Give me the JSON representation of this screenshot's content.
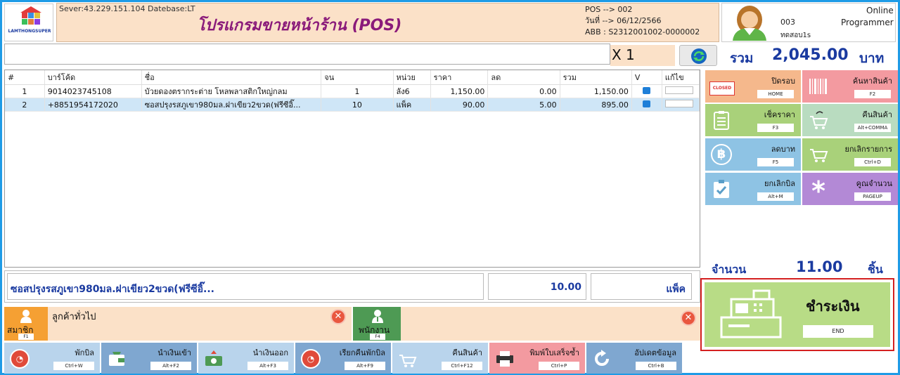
{
  "header": {
    "server": "Sever:43.229.151.104 Datebase:LT",
    "title": "โปรแกรมขายหน้าร้าน (POS)",
    "pos": "POS --> 002",
    "date": "วันที่ --> 06/12/2566",
    "abb": "ABB : S2312001002-0000002"
  },
  "logo": {
    "text": "LAMTHONGSUPER"
  },
  "user": {
    "status": "Online",
    "code": "003",
    "role": "Programmer",
    "name": "ทดสอบ1s"
  },
  "scan": {
    "value": "",
    "multiplier": "X 1"
  },
  "total": {
    "label": "รวม",
    "value": "2,045.00",
    "currency": "บาท"
  },
  "grid": {
    "headers": [
      "#",
      "บาร์โค้ด",
      "ชื่อ",
      "จน",
      "หน่วย",
      "ราคา",
      "ลด",
      "รวม",
      "V",
      "แก้ไข"
    ],
    "rows": [
      {
        "no": "1",
        "barcode": "9014023745108",
        "name": "บัวยดองตรากระต่าย โหลพลาสติกใหญ่กลม",
        "qty": "1",
        "unit": "ลัง6",
        "price": "1,150.00",
        "discount": "0.00",
        "total": "1,150.00"
      },
      {
        "no": "2",
        "barcode": "+8851954172020",
        "name": "ซอสปรุงรสภูเขา980มล.ฝาเขียว2ขวด(ฟรีซีอิ๊...",
        "qty": "10",
        "unit": "แพ็ค",
        "price": "90.00",
        "discount": "5.00",
        "total": "895.00"
      }
    ]
  },
  "detail": {
    "name": "ซอสปรุงรสภูเขา980มล.ฝาเขียว2ขวด(ฟรีซีอิ๊...",
    "qty": "10.00",
    "unit": "แพ็ค"
  },
  "customer": {
    "member_label": "สมาชิก",
    "member_key": "F1",
    "name": "ลูกค้าทั่วไป"
  },
  "employee": {
    "label": "พนักงาน",
    "key": "F4",
    "name": ""
  },
  "right_buttons": [
    {
      "label": "ปิดรอบ",
      "key": "HOME",
      "icon": "closed-icon",
      "icon_text": "CLOSED"
    },
    {
      "label": "ค้นหาสินค้า",
      "key": "F2",
      "icon": "barcode-icon",
      "icon_text": ""
    },
    {
      "label": "เช็คราคา",
      "key": "F3",
      "icon": "clipboard-icon",
      "icon_text": ""
    },
    {
      "label": "คืนสินค้า",
      "key": "Alt+COMMA",
      "icon": "cart-return-icon",
      "icon_text": ""
    },
    {
      "label": "ลดบาท",
      "key": "F5",
      "icon": "baht-icon",
      "icon_text": "฿"
    },
    {
      "label": "ยกเลิกรายการ",
      "key": "Ctrl+D",
      "icon": "cart-cancel-icon",
      "icon_text": ""
    },
    {
      "label": "ยกเลิกบิล",
      "key": "Alt+M",
      "icon": "clipboard-check-icon",
      "icon_text": ""
    },
    {
      "label": "คูณจำนวน",
      "key": "PAGEUP",
      "icon": "asterisk-icon",
      "icon_text": "*"
    }
  ],
  "summary": {
    "qty_label": "จำนวน",
    "qty_value": "11.00",
    "qty_unit": "ชิ้น"
  },
  "pay": {
    "label": "ชำระเงิน",
    "key": "END"
  },
  "bottom_buttons": [
    {
      "label": "พักบิล",
      "key": "Ctrl+W",
      "icon": "timer-icon"
    },
    {
      "label": "นำเงินเข้า",
      "key": "Alt+F2",
      "icon": "wallet-in-icon"
    },
    {
      "label": "นำเงินออก",
      "key": "Alt+F3",
      "icon": "money-out-icon"
    },
    {
      "label": "เรียกคืนพักบิล",
      "key": "Alt+F9",
      "icon": "timer-restore-icon"
    },
    {
      "label": "คืนสินค้า",
      "key": "Ctrl+F12",
      "icon": "cart-return-icon"
    },
    {
      "label": "พิมพ์ใบเสร็จซ้ำ",
      "key": "Ctrl+P",
      "icon": "printer-icon"
    },
    {
      "label": "อัปเดตข้อมูล",
      "key": "Ctrl+B",
      "icon": "refresh-icon"
    }
  ],
  "colors": {
    "header_bg": "#fbe1c8",
    "accent_text": "#1a3aa0",
    "title": "#8a1a7a",
    "pay_bg": "#b8dc86",
    "pay_border": "#d42020"
  }
}
